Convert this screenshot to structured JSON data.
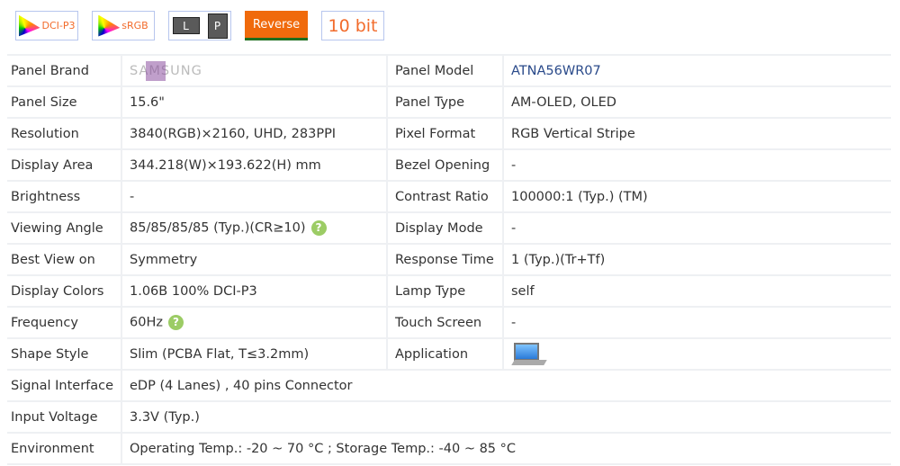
{
  "badges": {
    "dcip3": "DCI-P3",
    "srgb": "sRGB",
    "l": "L",
    "p": "P",
    "reverse": "Reverse",
    "bit": "10 bit"
  },
  "rows": [
    {
      "label": "Panel Brand",
      "value": "SAMSUNG",
      "label2": "Panel Model",
      "value2": "ATNA56WR07"
    },
    {
      "label": "Panel Size",
      "value": "15.6\"",
      "label2": "Panel Type",
      "value2": "AM-OLED, OLED"
    },
    {
      "label": "Resolution",
      "value": "3840(RGB)×2160, UHD, 283PPI",
      "label2": "Pixel Format",
      "value2": "RGB Vertical Stripe"
    },
    {
      "label": "Display Area",
      "value": "344.218(W)×193.622(H) mm",
      "label2": "Bezel Opening",
      "value2": "-"
    },
    {
      "label": "Brightness",
      "value": "-",
      "label2": "Contrast Ratio",
      "value2": "100000:1 (Typ.) (TM)"
    },
    {
      "label": "Viewing Angle",
      "value": "85/85/85/85 (Typ.)(CR≥10)",
      "label2": "Display Mode",
      "value2": "-"
    },
    {
      "label": "Best View on",
      "value": "Symmetry",
      "label2": "Response Time",
      "value2": "1 (Typ.)(Tr+Tf)"
    },
    {
      "label": "Display Colors",
      "value": "1.06B   100% DCI-P3",
      "label2": "Lamp Type",
      "value2": "self"
    },
    {
      "label": "Frequency",
      "value": "60Hz",
      "label2": "Touch Screen",
      "value2": "-"
    },
    {
      "label": "Shape Style",
      "value": "Slim (PCBA Flat, T≤3.2mm)",
      "label2": "Application"
    },
    {
      "label": "Signal Interface",
      "value": "eDP (4 Lanes) , 40 pins Connector"
    },
    {
      "label": "Input Voltage",
      "value": "3.3V (Typ.)"
    },
    {
      "label": "Environment",
      "value": "Operating Temp.: -20 ~ 70 °C ; Storage Temp.: -40 ~ 85 °C"
    }
  ],
  "help_icon": "?"
}
